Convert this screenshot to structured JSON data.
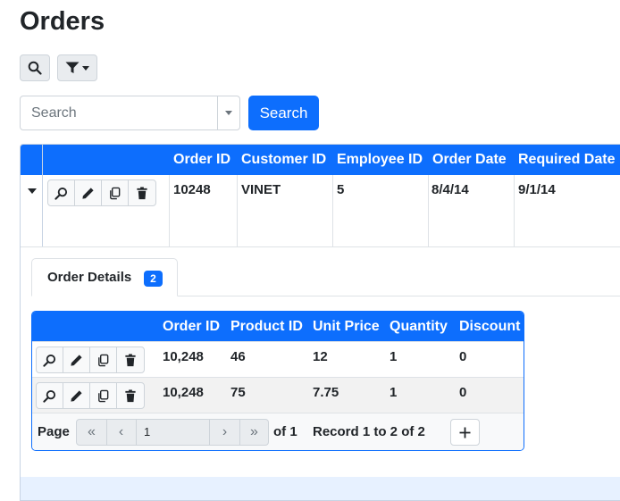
{
  "page": {
    "title": "Orders"
  },
  "toolbar": {
    "search_icon": "search-icon",
    "filter_icon": "filter-icon"
  },
  "search": {
    "placeholder": "Search",
    "value": "",
    "button_label": "Search"
  },
  "orders_grid": {
    "columns": [
      "Order ID",
      "Customer ID",
      "Employee ID",
      "Order Date",
      "Required Date"
    ],
    "rows": [
      {
        "order_id": "10248",
        "customer_id": "VINET",
        "employee_id": "5",
        "order_date": "8/4/14",
        "required_date": "9/1/14"
      }
    ],
    "row_actions": [
      "view-icon",
      "edit-icon",
      "copy-icon",
      "delete-icon"
    ]
  },
  "detail_tabs": [
    {
      "label": "Order Details",
      "badge": "2"
    }
  ],
  "order_details_grid": {
    "columns": [
      "Order ID",
      "Product ID",
      "Unit Price",
      "Quantity",
      "Discount"
    ],
    "rows": [
      {
        "order_id": "10,248",
        "product_id": "46",
        "unit_price": "12",
        "quantity": "1",
        "discount": "0"
      },
      {
        "order_id": "10,248",
        "product_id": "75",
        "unit_price": "7.75",
        "quantity": "1",
        "discount": "0"
      }
    ],
    "pager": {
      "page_label": "Page",
      "current_page": "1",
      "of_label": "of 1",
      "record_label": "Record 1 to 2 of 2"
    }
  },
  "colors": {
    "primary": "#0d6efd",
    "header_text": "#ffffff",
    "border": "#dee2e6"
  }
}
